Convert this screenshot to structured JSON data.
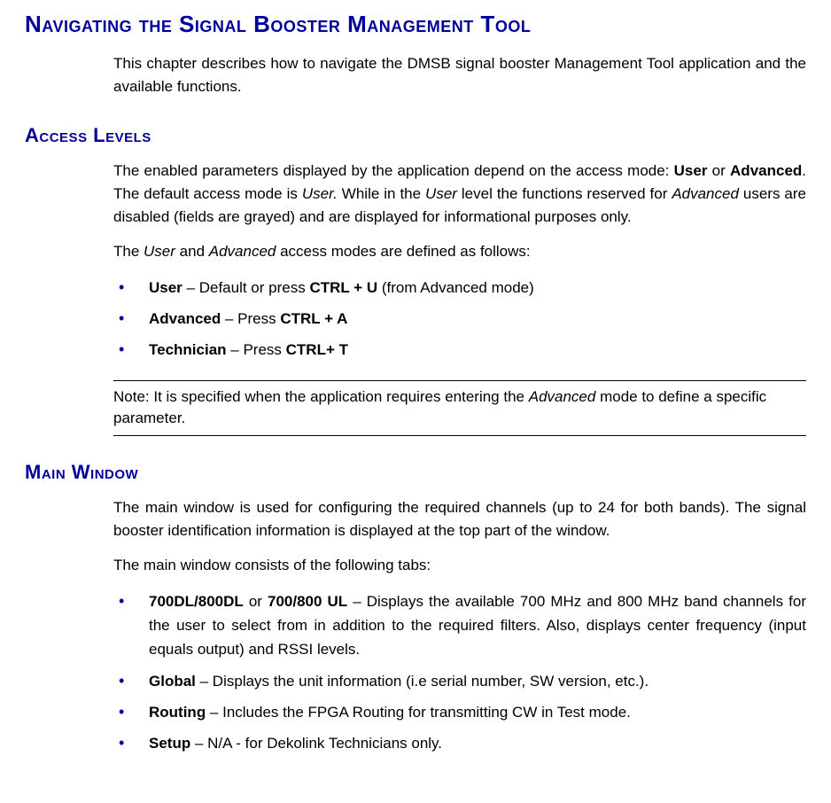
{
  "title": "Navigating the Signal Booster Management Tool",
  "intro": "This chapter describes how to navigate the DMSB signal booster Management Tool application and the available functions.",
  "sections": {
    "access": {
      "heading": "Access Levels",
      "para1_pre": "The enabled parameters displayed by the application depend on the access mode: ",
      "para1_user": "User",
      "para1_or": " or ",
      "para1_adv": "Advanced",
      "para1_mid1": ". The default access mode is ",
      "para1_ui1": "User.",
      "para1_mid2": " While in the ",
      "para1_ui2": "User",
      "para1_mid3": " level the functions reserved for ",
      "para1_ai": "Advanced",
      "para1_tail": " users are disabled (fields are grayed) and are displayed for informational purposes only.",
      "para2_pre": "The ",
      "para2_u": "User",
      "para2_and": " and ",
      "para2_a": "Advanced",
      "para2_tail": " access modes are defined as follows:",
      "b1_label": "User",
      "b1_mid": " – Default or press ",
      "b1_key": "CTRL + U",
      "b1_tail": " (from Advanced mode)",
      "b2_label": "Advanced",
      "b2_mid": " – Press ",
      "b2_key": "CTRL + A",
      "b3_label": "Technician",
      "b3_mid": " – Press ",
      "b3_key": "CTRL+ T",
      "note_pre": "Note: It is specified when the application requires entering the ",
      "note_i": "Advanced",
      "note_tail": " mode to define a specific parameter."
    },
    "main": {
      "heading": "Main Window",
      "para1": "The main window is used for configuring the required channels (up to 24 for both bands). The signal booster identification information is displayed at the top part of the window.",
      "para2": "The main window consists of the following tabs:",
      "b1_label1": "700DL/800DL",
      "b1_or": " or ",
      "b1_label2": "700/800 UL",
      "b1_tail": " – Displays the available 700 MHz and 800 MHz band channels for the user to select from in addition to the required filters. Also, displays center frequency (input equals output) and RSSI levels.",
      "b2_label": "Global",
      "b2_tail": " – Displays the unit information (i.e serial number, SW version, etc.).",
      "b3_label": "Routing",
      "b3_tail": " – Includes the FPGA Routing for transmitting CW in Test mode.",
      "b4_label": "Setup",
      "b4_tail": " – N/A - for Dekolink Technicians only."
    }
  }
}
